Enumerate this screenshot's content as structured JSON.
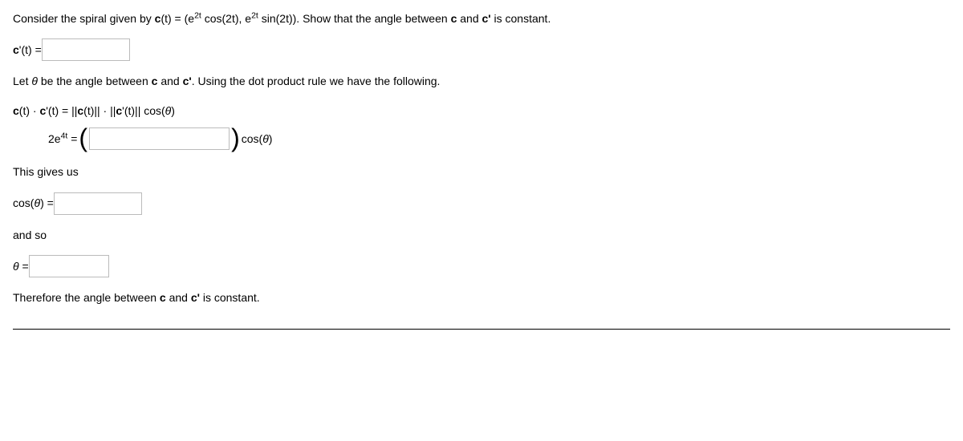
{
  "problem": {
    "intro_a": "Consider the spiral given by ",
    "intro_b": "(t) = (e",
    "intro_c": " cos(2t), e",
    "intro_d": " sin(2t)). Show that the angle between ",
    "intro_e": " and ",
    "intro_f": " is constant."
  },
  "lines": {
    "cprime_label_a": "c",
    "cprime_label_b": "'(t) = ",
    "let_a": "Let ",
    "let_b": " be the angle between ",
    "let_c": " and ",
    "let_d": ". Using the dot product rule we have the following.",
    "dot_a": "c",
    "dot_b": "(t) · ",
    "dot_c": "c",
    "dot_d": "'(t)  =  ||",
    "dot_e": "c",
    "dot_f": "(t)|| · ||",
    "dot_g": "c",
    "dot_h": "'(t)|| cos(",
    "dot_i": ")",
    "e4t_a": "2e",
    "e4t_sup": "4t",
    "e4t_b": "  =  ",
    "e4t_c": " cos(",
    "e4t_d": ")",
    "gives": "This gives us",
    "cos_a": "cos(",
    "cos_b": ")  =  ",
    "andso": "and so",
    "theta_eq": " = ",
    "conclusion_a": "Therefore the angle between ",
    "conclusion_b": " and ",
    "conclusion_c": " is constant."
  },
  "symbols": {
    "c_bold": "c",
    "cprime_bold": "c'",
    "theta": "θ",
    "sup2t": "2t"
  }
}
